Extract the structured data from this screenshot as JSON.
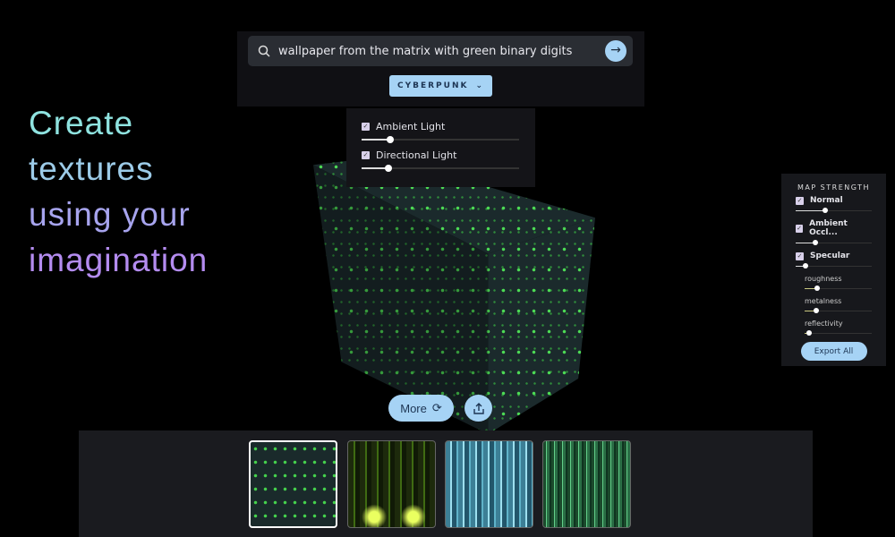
{
  "hero": {
    "lines": [
      "Create",
      "textures",
      "using your",
      "imagination"
    ]
  },
  "search": {
    "value": "wallpaper from the matrix with green binary digits",
    "submit_icon": "arrow-right-icon"
  },
  "style_dropdown": {
    "selected": "CYBERPUNK"
  },
  "lights": [
    {
      "label": "Ambient Light",
      "checked": true,
      "value": 0.18
    },
    {
      "label": "Directional Light",
      "checked": true,
      "value": 0.17
    }
  ],
  "map_strength": {
    "title": "MAP STRENGTH",
    "maps": [
      {
        "label": "Normal",
        "checked": true,
        "value": 0.4
      },
      {
        "label": "Ambient Occl...",
        "checked": true,
        "value": 0.27
      },
      {
        "label": "Specular",
        "checked": true,
        "value": 0.14
      }
    ],
    "specular_params": [
      {
        "label": "roughness",
        "value": 0.2
      },
      {
        "label": "metalness",
        "value": 0.19
      },
      {
        "label": "reflectivity",
        "value": 0.08
      }
    ],
    "export_label": "Export All"
  },
  "actions": {
    "more_label": "More",
    "share_icon": "share-icon"
  },
  "thumbnails": [
    {
      "selected": true
    },
    {
      "selected": false
    },
    {
      "selected": false
    },
    {
      "selected": false
    }
  ],
  "colors": {
    "accent": "#a6d3f5",
    "panel": "#17181c"
  }
}
